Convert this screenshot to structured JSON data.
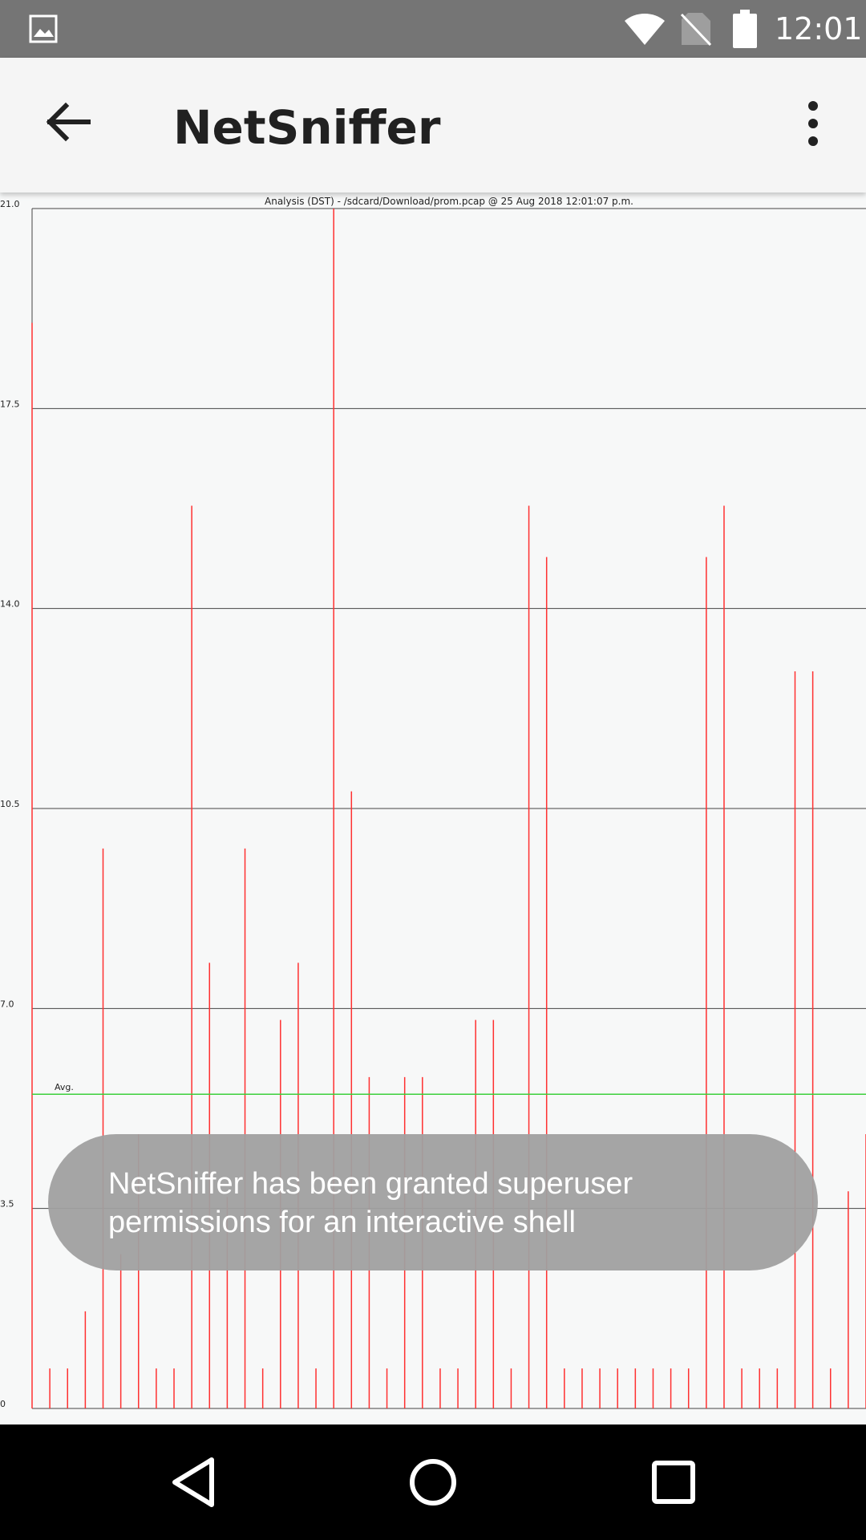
{
  "status_bar": {
    "time": "12:01",
    "icons": [
      "gallery-icon",
      "wifi-icon",
      "no-sim-icon",
      "battery-icon"
    ]
  },
  "app_bar": {
    "title": "NetSniffer",
    "icons": [
      "arrow-back-icon",
      "more-vert-icon"
    ]
  },
  "chart_data": {
    "type": "bar",
    "title": "Analysis (DST) - /sdcard/Download/prom.pcap @ 25 Aug 2018 12:01:07 p.m.",
    "ylim": [
      0,
      21
    ],
    "yticks": [
      0,
      3.5,
      7.0,
      10.5,
      14.0,
      17.5,
      21.0
    ],
    "ytick_labels": [
      "0",
      "3.5",
      "7.0",
      "10.5",
      "14.0",
      "17.5",
      "21.0"
    ],
    "grid": true,
    "bar_color": "#ff3030",
    "average": {
      "label": "Avg.",
      "value": 5.5,
      "color": "#3cd03c"
    },
    "values": [
      19,
      0.7,
      0.7,
      1.7,
      9.8,
      2.7,
      4.8,
      0.7,
      0.7,
      15.8,
      7.8,
      3.7,
      9.8,
      0.7,
      6.8,
      7.8,
      0.7,
      21,
      10.8,
      5.8,
      0.7,
      5.8,
      5.8,
      0.7,
      0.7,
      6.8,
      6.8,
      0.7,
      15.8,
      14.9,
      0.7,
      0.7,
      0.7,
      0.7,
      0.7,
      0.7,
      0.7,
      0.7,
      14.9,
      15.8,
      0.7,
      0.7,
      0.7,
      12.9,
      12.9,
      0.7,
      3.8,
      4.8
    ]
  },
  "toast": {
    "message": "NetSniffer has been granted superuser permissions for an interactive shell"
  },
  "nav_bar": {
    "icons": [
      "nav-back-icon",
      "nav-home-icon",
      "nav-recents-icon"
    ]
  }
}
